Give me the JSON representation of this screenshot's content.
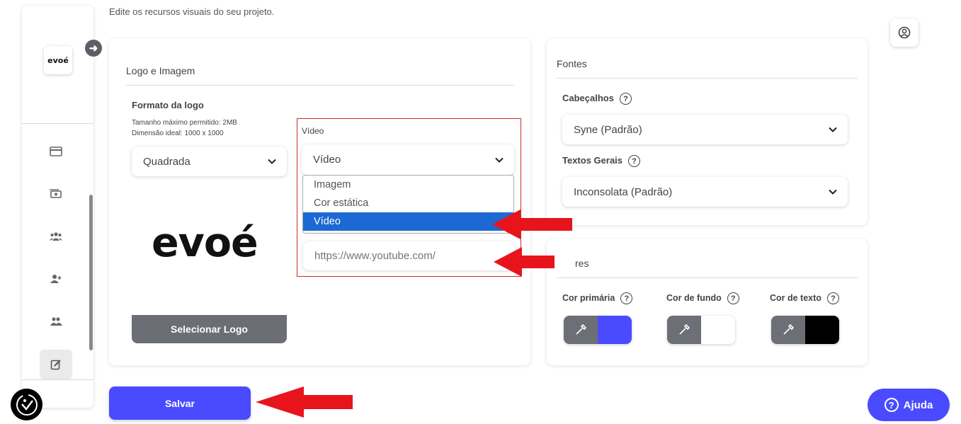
{
  "page": {
    "subtitle": "Edite os recursos visuais do seu projeto."
  },
  "sidebar": {
    "brand": "evoé",
    "icons": [
      "card-icon",
      "money-icon",
      "group-icon",
      "add-user-icon",
      "team-icon",
      "edit-icon"
    ]
  },
  "logo_card": {
    "title": "Logo e Imagem",
    "format_label": "Formato da logo",
    "max_size": "Tamanho máximo permitido: 2MB",
    "ideal_dim": "Dimensão ideal: 1000 x 1000",
    "format_value": "Quadrada",
    "preview_text": "evoé",
    "select_logo": "Selecionar Logo",
    "video_label": "Vídeo",
    "video_select_value": "Vídeo",
    "video_options": [
      "Imagem",
      "Cor estática",
      "Vídeo"
    ],
    "video_selected_index": 2,
    "video_url_placeholder": "https://www.youtube.com/"
  },
  "fonts_card": {
    "title": "Fontes",
    "headers_label": "Cabeçalhos",
    "headers_value": "Syne (Padrão)",
    "body_label": "Textos Gerais",
    "body_value": "Inconsolata (Padrão)"
  },
  "colors_card": {
    "title": "res",
    "primary_label": "Cor primária",
    "background_label": "Cor de fundo",
    "text_label": "Cor de texto",
    "primary_color": "#4a4aff",
    "background_color": "#ffffff",
    "text_color": "#000000"
  },
  "actions": {
    "save": "Salvar",
    "help": "Ajuda"
  },
  "colors": {
    "accent": "#4a4aff",
    "annotation": "#e8141c",
    "selection": "#1c69d3"
  }
}
